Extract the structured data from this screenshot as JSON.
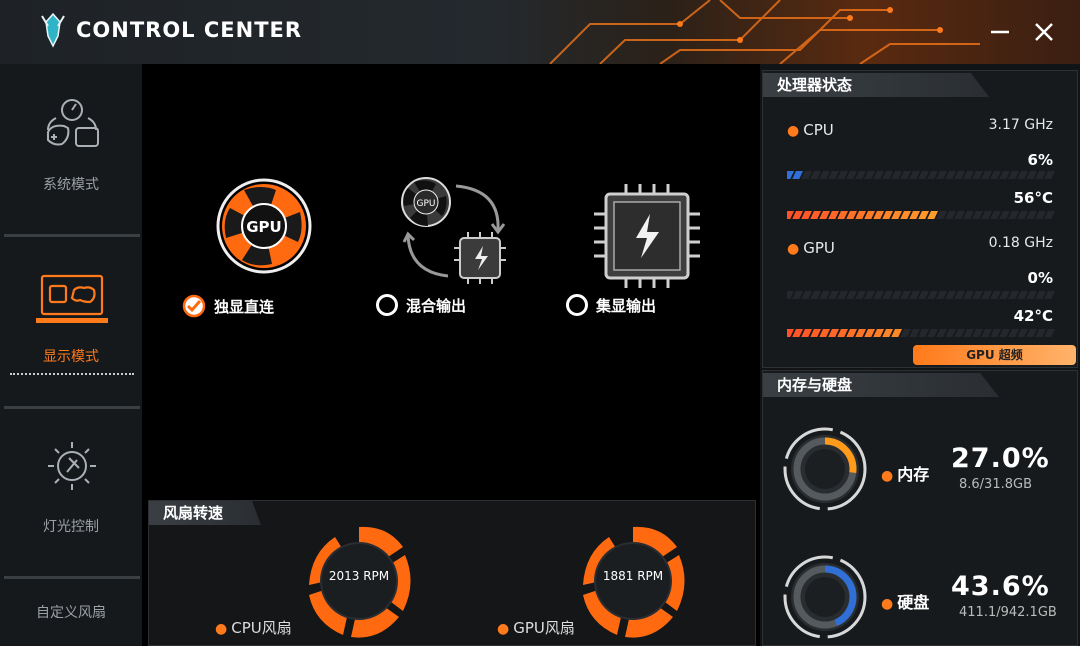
{
  "app": {
    "title": "CONTROL CENTER"
  },
  "colors": {
    "accent": "#ff7a1a",
    "bg": "#000000",
    "panel": "#16191c"
  },
  "sidebar": {
    "items": [
      {
        "label": "系统模式",
        "icon": "gamepad-speed-icon"
      },
      {
        "label": "显示模式",
        "icon": "laptop-gamepad-icon",
        "active": true
      },
      {
        "label": "灯光控制",
        "icon": "light-bulb-icon"
      },
      {
        "label": "自定义风扇",
        "icon": ""
      }
    ]
  },
  "display_modes": [
    {
      "label": "独显直连",
      "icon_text": "GPU",
      "selected": true
    },
    {
      "label": "混合输出",
      "icon_text": "GPU",
      "selected": false
    },
    {
      "label": "集显输出",
      "selected": false
    }
  ],
  "fans": {
    "title": "风扇转速",
    "cpu": {
      "label": "CPU风扇",
      "rpm": "2013 RPM"
    },
    "gpu": {
      "label": "GPU风扇",
      "rpm": "1881 RPM"
    }
  },
  "processor": {
    "title": "处理器状态",
    "cpu": {
      "label": "CPU",
      "freq": "3.17 GHz",
      "usage": "6%",
      "temp": "56°C",
      "usage_fraction": 0.06,
      "temp_fraction": 0.56
    },
    "gpu": {
      "label": "GPU",
      "freq": "0.18 GHz",
      "usage": "0%",
      "temp": "42°C",
      "usage_fraction": 0.0,
      "temp_fraction": 0.42
    },
    "overclock_button": "GPU 超频"
  },
  "storage": {
    "title": "内存与硬盘",
    "memory": {
      "label": "内存",
      "percent": "27.0%",
      "detail": "8.6/31.8GB",
      "fraction": 0.27
    },
    "disk": {
      "label": "硬盘",
      "percent": "43.6%",
      "detail": "411.1/942.1GB",
      "fraction": 0.436
    }
  }
}
